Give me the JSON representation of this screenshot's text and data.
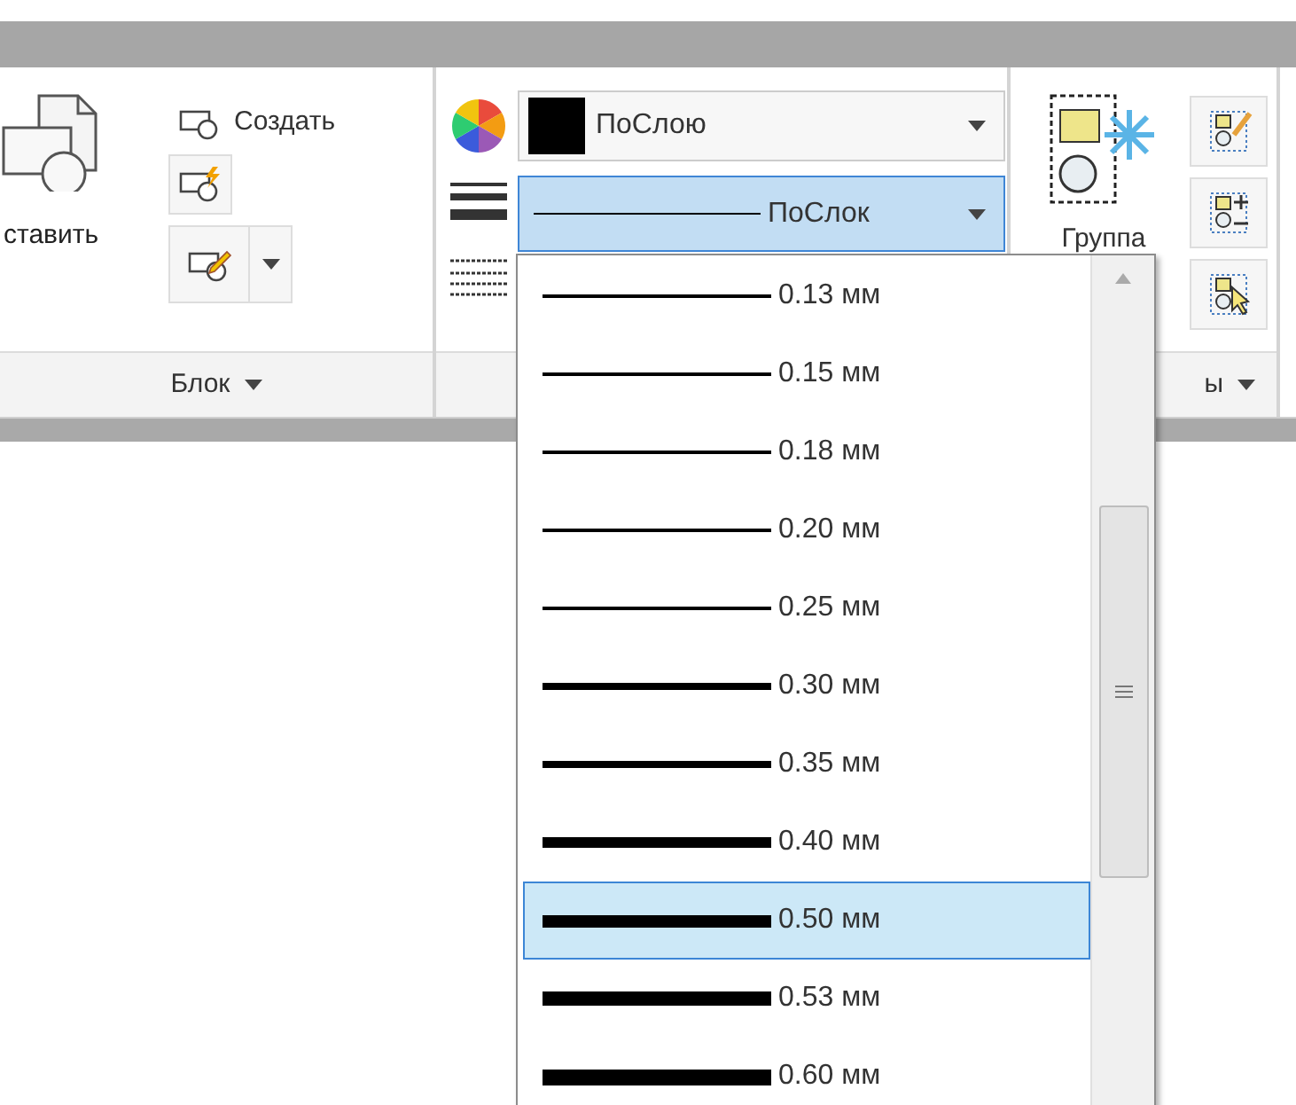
{
  "block_panel": {
    "insert_label": "ставить",
    "create_label": "Создать",
    "footer_label": "Блок"
  },
  "properties_panel": {
    "color_combo": {
      "value": "ПоСлою"
    },
    "lineweight_combo": {
      "value": "ПоСлок",
      "expanded": true
    }
  },
  "groups_panel": {
    "group_label": "Группа",
    "footer_label": "ы"
  },
  "lineweight_list": [
    {
      "label": "0.13 мм",
      "kind": "hairline",
      "selected": false
    },
    {
      "label": "0.15 мм",
      "kind": "hairline",
      "selected": false
    },
    {
      "label": "0.18 мм",
      "kind": "hairline",
      "selected": false
    },
    {
      "label": "0.20 мм",
      "kind": "hairline",
      "selected": false
    },
    {
      "label": "0.25 мм",
      "kind": "hairline",
      "selected": false
    },
    {
      "label": "0.30 мм",
      "kind": "medium",
      "selected": false
    },
    {
      "label": "0.35 мм",
      "kind": "medium",
      "selected": false
    },
    {
      "label": "0.40 мм",
      "kind": "heavy",
      "selected": false
    },
    {
      "label": "0.50 мм",
      "kind": "heavier",
      "selected": true
    },
    {
      "label": "0.53 мм",
      "kind": "heaviest",
      "selected": false
    },
    {
      "label": "0.60 мм",
      "kind": "extra",
      "selected": false
    }
  ]
}
